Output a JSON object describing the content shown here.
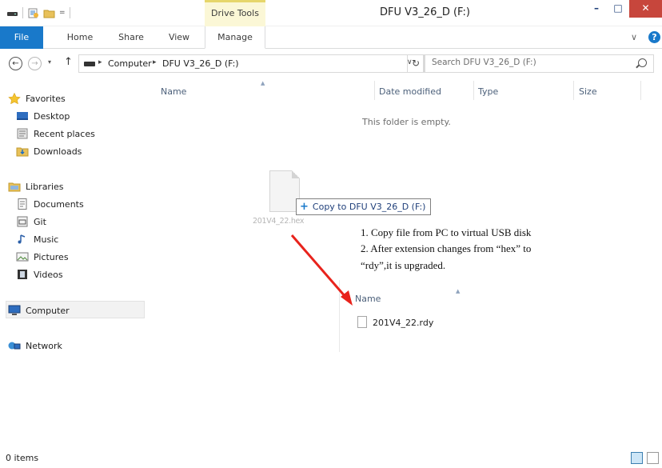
{
  "window": {
    "title": "DFU V3_26_D (F:)",
    "context_tab": "Drive Tools",
    "minimize_glyph": "–",
    "maximize_glyph": "□",
    "close_glyph": "✕"
  },
  "ribbon": {
    "tabs": [
      "File",
      "Home",
      "Share",
      "View",
      "Manage"
    ],
    "expand_glyph": "∨",
    "help_glyph": "?"
  },
  "navigation": {
    "back_glyph": "←",
    "forward_glyph": "→",
    "recent_glyph": "▾",
    "up_glyph": "↑",
    "breadcrumb": [
      "Computer",
      "DFU V3_26_D (F:)"
    ],
    "breadcrumb_sep": "▸",
    "dropdown_glyph": "∨",
    "refresh_glyph": "↻",
    "search_placeholder": "Search DFU V3_26_D (F:)"
  },
  "sidebar": {
    "favorites": {
      "label": "Favorites",
      "items": [
        "Desktop",
        "Recent places",
        "Downloads"
      ]
    },
    "libraries": {
      "label": "Libraries",
      "items": [
        "Documents",
        "Git",
        "Music",
        "Pictures",
        "Videos"
      ]
    },
    "computer": "Computer",
    "network": "Network"
  },
  "columns": [
    "Name",
    "Date modified",
    "Type",
    "Size"
  ],
  "empty_message": "This folder is empty.",
  "drag": {
    "file_name": "201V4_22.hex",
    "tooltip": "Copy to DFU V3_26_D (F:)",
    "tooltip_plus": "+"
  },
  "annotation": {
    "line1": "1. Copy file from PC to virtual USB disk",
    "line2": "2. After extension changes from “hex” to",
    "line3": "“rdy”,it is upgraded.",
    "arrow_color": "#e8231c"
  },
  "result": {
    "column": "Name",
    "file_name": "201V4_22.rdy"
  },
  "status": {
    "items": "0 items"
  },
  "colors": {
    "file_tab": "#1979ca",
    "close_button": "#c7463c",
    "drive_tools_bg": "#fbf7d6"
  }
}
